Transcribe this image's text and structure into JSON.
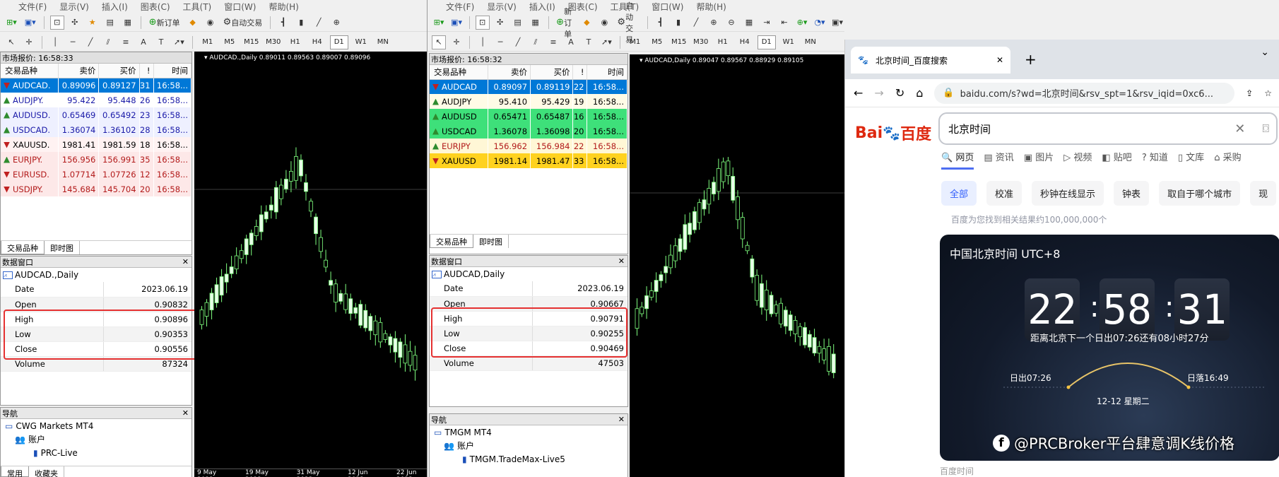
{
  "mt4a": {
    "menu": [
      "文件(F)",
      "显示(V)",
      "插入(I)",
      "图表(C)",
      "工具(T)",
      "窗口(W)",
      "帮助(H)"
    ],
    "toolbar": {
      "new_order": "新订单",
      "autotrade": "自动交易"
    },
    "timeframes": [
      "M1",
      "M5",
      "M15",
      "M30",
      "H1",
      "H4",
      "D1",
      "W1",
      "MN"
    ],
    "market_watch": {
      "title": "市场报价: 16:58:33",
      "headers": [
        "交易品种",
        "卖价",
        "买价",
        "!",
        "时间"
      ],
      "rows": [
        {
          "sym": "AUDCAD.",
          "bid": "0.89096",
          "ask": "0.89127",
          "spread": "31",
          "time": "16:58...",
          "dir": "down",
          "bg": "#0078d7",
          "fg": "#ffffff"
        },
        {
          "sym": "AUDJPY.",
          "bid": "95.422",
          "ask": "95.448",
          "spread": "26",
          "time": "16:58...",
          "dir": "up",
          "bg": "#ffffff",
          "fg": "#1a1aa8"
        },
        {
          "sym": "AUDUSD.",
          "bid": "0.65469",
          "ask": "0.65492",
          "spread": "23",
          "time": "16:58...",
          "dir": "up",
          "bg": "#eef0ff",
          "fg": "#1a1aa8"
        },
        {
          "sym": "USDCAD.",
          "bid": "1.36074",
          "ask": "1.36102",
          "spread": "28",
          "time": "16:58...",
          "dir": "up",
          "bg": "#eef0ff",
          "fg": "#1a1aa8"
        },
        {
          "sym": "XAUUSD.",
          "bid": "1981.41",
          "ask": "1981.59",
          "spread": "18",
          "time": "16:58...",
          "dir": "down",
          "bg": "#fff2f2",
          "fg": "#000000"
        },
        {
          "sym": "EURJPY.",
          "bid": "156.956",
          "ask": "156.991",
          "spread": "35",
          "time": "16:58...",
          "dir": "up",
          "bg": "#fde8e8",
          "fg": "#b21a1a"
        },
        {
          "sym": "EURUSD.",
          "bid": "1.07714",
          "ask": "1.07726",
          "spread": "12",
          "time": "16:58...",
          "dir": "down",
          "bg": "#fde8e8",
          "fg": "#b21a1a"
        },
        {
          "sym": "USDJPY.",
          "bid": "145.684",
          "ask": "145.704",
          "spread": "20",
          "time": "16:58...",
          "dir": "down",
          "bg": "#fde8e8",
          "fg": "#b21a1a"
        }
      ],
      "tabs": [
        "交易品种",
        "即时图"
      ]
    },
    "data_window": {
      "title": "数据窗口",
      "symbol": "AUDCAD.,Daily",
      "rows": [
        {
          "k": "Date",
          "v": "2023.06.19"
        },
        {
          "k": "Open",
          "v": "0.90832"
        },
        {
          "k": "High",
          "v": "0.90896"
        },
        {
          "k": "Low",
          "v": "0.90353"
        },
        {
          "k": "Close",
          "v": "0.90556"
        },
        {
          "k": "Volume",
          "v": "87324"
        }
      ]
    },
    "navigator": {
      "title": "导航",
      "items": [
        "CWG Markets MT4",
        "账户",
        "PRC-Live"
      ],
      "tabs": [
        "常用",
        "收藏夹"
      ]
    },
    "chart": {
      "header": "AUDCAD.,Daily  0.89011 0.89563 0.89007 0.89096",
      "dates": [
        "9 May 2023",
        "19 May 2023",
        "31 May 2023",
        "12 Jun 2023",
        "22 Jun 2023"
      ]
    }
  },
  "mt4b": {
    "menu": [
      "文件(F)",
      "显示(V)",
      "插入(I)",
      "图表(C)",
      "工具(T)",
      "窗口(W)",
      "帮助(H)"
    ],
    "toolbar": {
      "new_order": "新订单",
      "autotrade": "自动交易"
    },
    "timeframes": [
      "M1",
      "M5",
      "M15",
      "M30",
      "H1",
      "H4",
      "D1",
      "W1",
      "MN"
    ],
    "market_watch": {
      "title": "市场报价: 16:58:32",
      "headers": [
        "交易品种",
        "卖价",
        "买价",
        "!",
        "时间"
      ],
      "rows": [
        {
          "sym": "AUDCAD",
          "bid": "0.89097",
          "ask": "0.89119",
          "spread": "22",
          "time": "16:58...",
          "dir": "down",
          "bg": "#0078d7",
          "fg": "#ffffff"
        },
        {
          "sym": "AUDJPY",
          "bid": "95.410",
          "ask": "95.429",
          "spread": "19",
          "time": "16:58...",
          "dir": "up",
          "bg": "#fffbe6",
          "fg": "#000000"
        },
        {
          "sym": "AUDUSD",
          "bid": "0.65471",
          "ask": "0.65487",
          "spread": "16",
          "time": "16:58...",
          "dir": "up",
          "bg": "#3ee07a",
          "fg": "#000000"
        },
        {
          "sym": "USDCAD",
          "bid": "1.36078",
          "ask": "1.36098",
          "spread": "20",
          "time": "16:58...",
          "dir": "up",
          "bg": "#3ee07a",
          "fg": "#000000"
        },
        {
          "sym": "EURJPY",
          "bid": "156.962",
          "ask": "156.984",
          "spread": "22",
          "time": "16:58...",
          "dir": "up",
          "bg": "#fff7d6",
          "fg": "#b21a1a"
        },
        {
          "sym": "XAUUSD",
          "bid": "1981.14",
          "ask": "1981.47",
          "spread": "33",
          "time": "16:58...",
          "dir": "down",
          "bg": "#ffd21f",
          "fg": "#000000"
        }
      ],
      "tabs": [
        "交易品种",
        "即时图"
      ]
    },
    "data_window": {
      "title": "数据窗口",
      "symbol": "AUDCAD,Daily",
      "rows": [
        {
          "k": "Date",
          "v": "2023.06.19"
        },
        {
          "k": "Open",
          "v": "0.90667"
        },
        {
          "k": "High",
          "v": "0.90791"
        },
        {
          "k": "Low",
          "v": "0.90255"
        },
        {
          "k": "Close",
          "v": "0.90469"
        },
        {
          "k": "Volume",
          "v": "47503"
        }
      ]
    },
    "navigator": {
      "title": "导航",
      "items": [
        "TMGM MT4",
        "账户",
        "TMGM.TradeMax-Live5"
      ]
    },
    "chart": {
      "header": "AUDCAD,Daily  0.89047 0.89567 0.88929 0.89105"
    }
  },
  "browser": {
    "tab_title": "北京时间_百度搜索",
    "url": "baidu.com/s?wd=北京时间&rsv_spt=1&rsv_iqid=0xc6...",
    "logo_a": "Bai",
    "logo_b": "百度",
    "query": "北京时间",
    "tabs": [
      "网页",
      "资讯",
      "图片",
      "视频",
      "贴吧",
      "知道",
      "文库",
      "采购"
    ],
    "chips": [
      "全部",
      "校准",
      "秒钟在线显示",
      "钟表",
      "取自于哪个城市",
      "现"
    ],
    "result_count": "百度为您找到相关结果约100,000,000个",
    "card": {
      "title": "中国北京时间 UTC+8",
      "h": "22",
      "m": "58",
      "s": "31",
      "sunrise_text": "距离北京下一个日出07:26还有08小时27分",
      "sunrise": "日出07:26",
      "sunset": "日落16:49",
      "date": "12-12  星期二"
    },
    "footer": "百度时间"
  },
  "watermark": "@PRCBroker平台肆意调K线价格"
}
